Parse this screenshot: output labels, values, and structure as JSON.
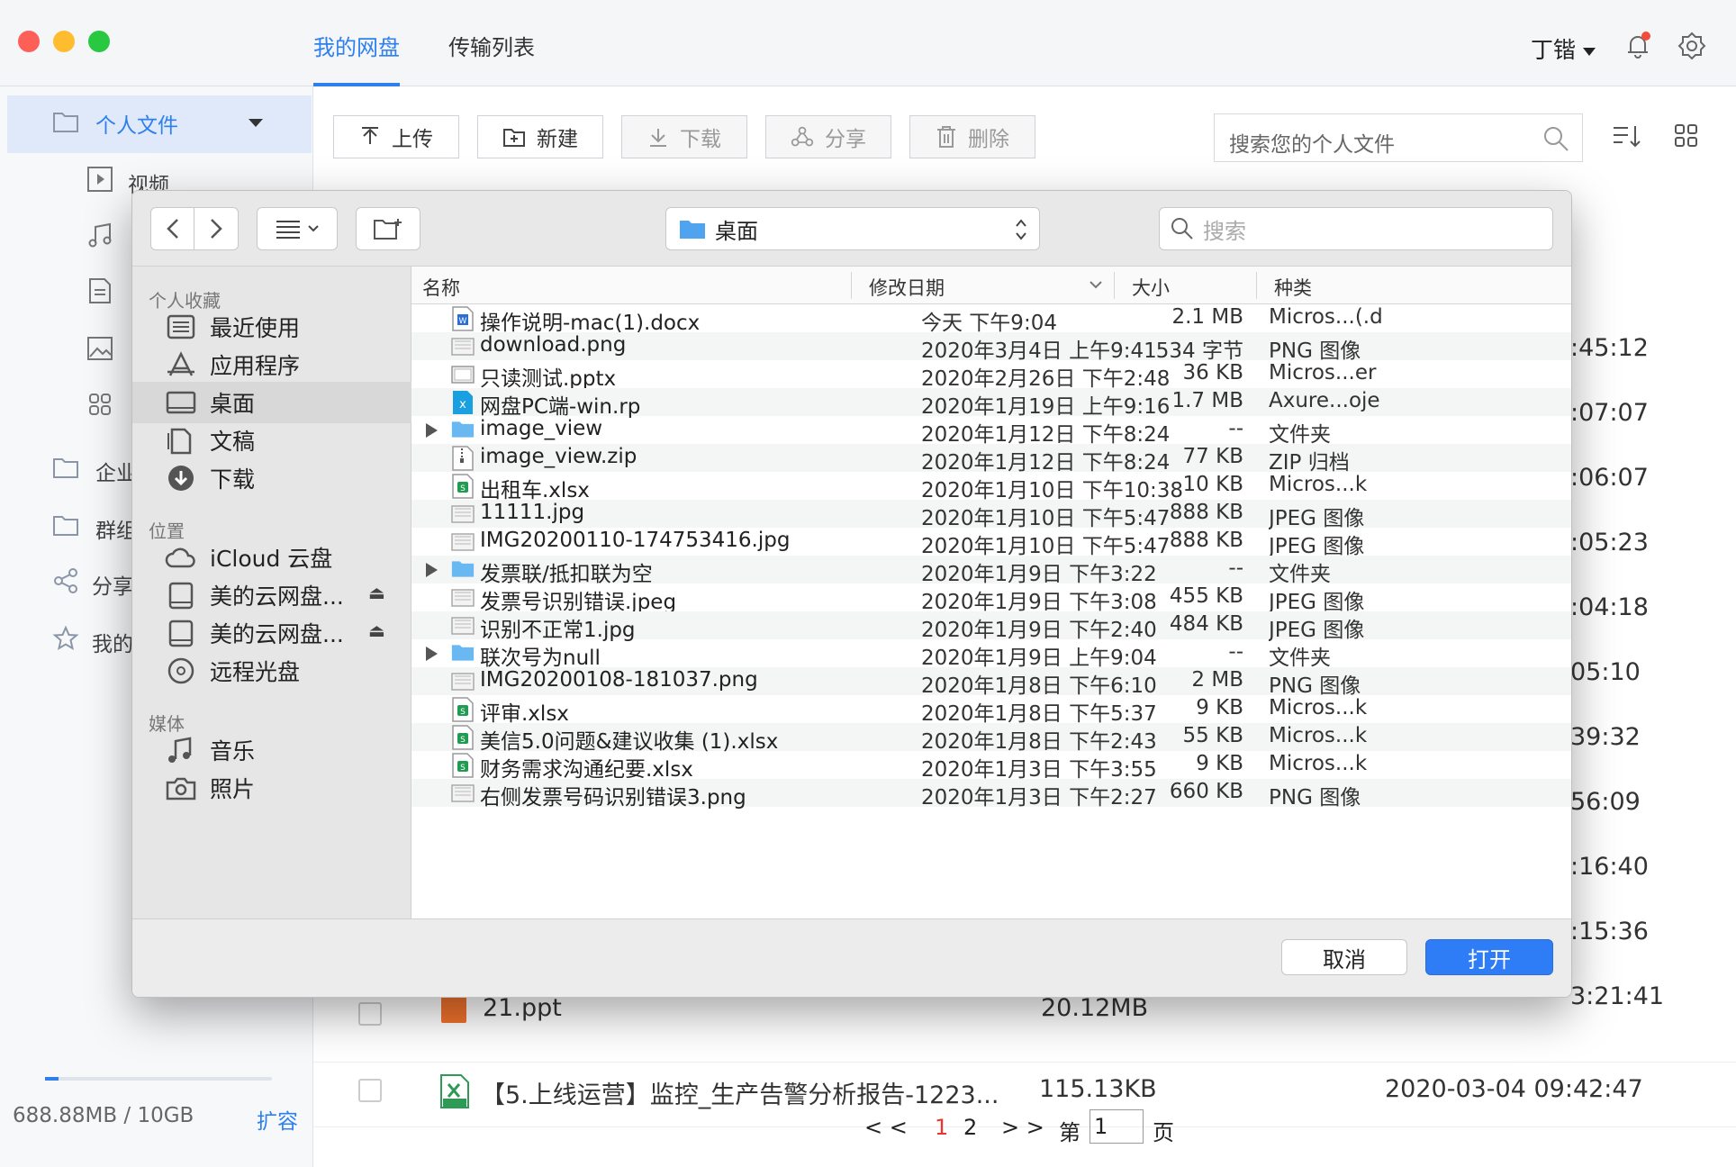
{
  "app": {
    "tabs": [
      {
        "label": "我的网盘"
      },
      {
        "label": "传输列表"
      }
    ],
    "user": "丁锴",
    "accent": "#2f80ed"
  },
  "sidebar": {
    "personal": "个人文件",
    "items": [
      {
        "label": "视频"
      },
      {
        "label": "企业"
      },
      {
        "label": "群组"
      },
      {
        "label": "分享"
      },
      {
        "label": "我的"
      }
    ],
    "quota": "688.88MB / 10GB",
    "expand": "扩容"
  },
  "toolbar": {
    "upload": "上传",
    "new": "新建",
    "download": "下载",
    "share": "分享",
    "delete": "删除",
    "search_placeholder": "搜索您的个人文件"
  },
  "background_rows": {
    "times": [
      ":45:12",
      ":07:07",
      ":06:07",
      ":05:23",
      ":04:18",
      "05:10",
      "39:32",
      "56:09",
      ":16:40",
      ":15:36",
      "3:21:41"
    ],
    "row1": {
      "name": "21.ppt",
      "size": "20.12MB"
    },
    "row2": {
      "name": "【5.上线运营】监控_生产告警分析报告-1223...",
      "size": "115.13KB",
      "time": "2020-03-04 09:42:47"
    }
  },
  "pager": {
    "prev": "< <",
    "p1": "1",
    "p2": "2",
    "next": "> >",
    "goto": "第",
    "input": "1",
    "unit": "页"
  },
  "dialog": {
    "location": "桌面",
    "search_placeholder": "搜索",
    "sections": {
      "favorites": "个人收藏",
      "locations": "位置",
      "media": "媒体"
    },
    "favorites": [
      {
        "label": "最近使用"
      },
      {
        "label": "应用程序"
      },
      {
        "label": "桌面"
      },
      {
        "label": "文稿"
      },
      {
        "label": "下载"
      }
    ],
    "locations": [
      {
        "label": "iCloud 云盘"
      },
      {
        "label": "美的云网盘..."
      },
      {
        "label": "美的云网盘..."
      },
      {
        "label": "远程光盘"
      }
    ],
    "media": [
      {
        "label": "音乐"
      },
      {
        "label": "照片"
      }
    ],
    "columns": {
      "name": "名称",
      "date": "修改日期",
      "size": "大小",
      "kind": "种类"
    },
    "files": [
      {
        "name": "操作说明-mac(1).docx",
        "date": "今天 下午9:04",
        "size": "2.1 MB",
        "kind": "Micros...(.d",
        "icon": "word-doc-icon"
      },
      {
        "name": "download.png",
        "date": "2020年3月4日 上午9:41",
        "size": "534 字节",
        "kind": "PNG 图像",
        "icon": "image-file-icon"
      },
      {
        "name": "只读测试.pptx",
        "date": "2020年2月26日 下午2:48",
        "size": "36 KB",
        "kind": "Micros...er",
        "icon": "ppt-file-icon"
      },
      {
        "name": "网盘PC端-win.rp",
        "date": "2020年1月19日 上午9:16",
        "size": "1.7 MB",
        "kind": "Axure...oje",
        "icon": "axure-file-icon"
      },
      {
        "name": "image_view",
        "date": "2020年1月12日 下午8:24",
        "size": "--",
        "kind": "文件夹",
        "icon": "folder-icon",
        "folder": true
      },
      {
        "name": "image_view.zip",
        "date": "2020年1月12日 下午8:24",
        "size": "77 KB",
        "kind": "ZIP 归档",
        "icon": "zip-file-icon"
      },
      {
        "name": "出租车.xlsx",
        "date": "2020年1月10日 下午10:38",
        "size": "10 KB",
        "kind": "Micros...k",
        "icon": "excel-file-icon"
      },
      {
        "name": "11111.jpg",
        "date": "2020年1月10日 下午5:47",
        "size": "888 KB",
        "kind": "JPEG 图像",
        "icon": "image-file-icon"
      },
      {
        "name": "IMG20200110-174753416.jpg",
        "date": "2020年1月10日 下午5:47",
        "size": "888 KB",
        "kind": "JPEG 图像",
        "icon": "image-file-icon"
      },
      {
        "name": "发票联/抵扣联为空",
        "date": "2020年1月9日 下午3:22",
        "size": "--",
        "kind": "文件夹",
        "icon": "folder-icon",
        "folder": true
      },
      {
        "name": "发票号识别错误.jpeg",
        "date": "2020年1月9日 下午3:08",
        "size": "455 KB",
        "kind": "JPEG 图像",
        "icon": "image-file-icon"
      },
      {
        "name": "识别不正常1.jpg",
        "date": "2020年1月9日 下午2:40",
        "size": "484 KB",
        "kind": "JPEG 图像",
        "icon": "image-file-icon"
      },
      {
        "name": "联次号为null",
        "date": "2020年1月9日 上午9:04",
        "size": "--",
        "kind": "文件夹",
        "icon": "folder-icon",
        "folder": true
      },
      {
        "name": "IMG20200108-181037.png",
        "date": "2020年1月8日 下午6:10",
        "size": "2 MB",
        "kind": "PNG 图像",
        "icon": "image-file-icon"
      },
      {
        "name": "评审.xlsx",
        "date": "2020年1月8日 下午5:37",
        "size": "9 KB",
        "kind": "Micros...k",
        "icon": "excel-file-icon"
      },
      {
        "name": "美信5.0问题&建议收集 (1).xlsx",
        "date": "2020年1月8日 下午2:43",
        "size": "55 KB",
        "kind": "Micros...k",
        "icon": "excel-file-icon"
      },
      {
        "name": "财务需求沟通纪要.xlsx",
        "date": "2020年1月3日 下午3:55",
        "size": "9 KB",
        "kind": "Micros...k",
        "icon": "excel-file-icon"
      },
      {
        "name": "右侧发票号码识别错误3.png",
        "date": "2020年1月3日 下午2:27",
        "size": "660 KB",
        "kind": "PNG 图像",
        "icon": "image-file-icon"
      }
    ],
    "cancel": "取消",
    "open": "打开"
  }
}
